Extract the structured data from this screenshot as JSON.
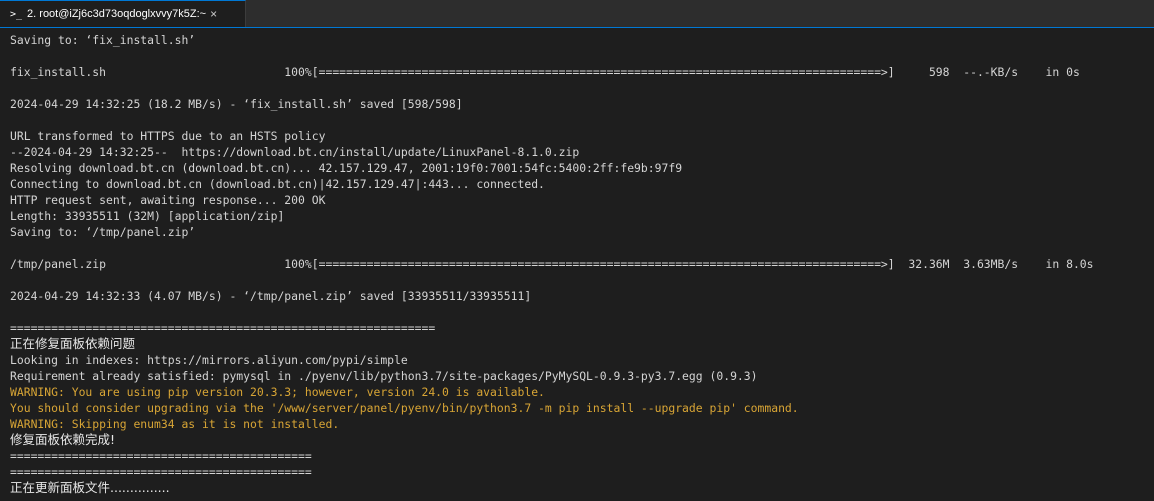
{
  "tab": {
    "prompt_glyph": ">_",
    "title": "2. root@iZj6c3d73oqdoglxvvy7k5Z:~",
    "close_glyph": "×"
  },
  "terminal": {
    "lines": [
      {
        "text": "Saving to: ‘fix_install.sh’",
        "style": "normal"
      },
      {
        "text": "",
        "style": "normal"
      },
      {
        "text": "fix_install.sh                          100%[==================================================================================>]     598  --.-KB/s    in 0s",
        "style": "normal"
      },
      {
        "text": "",
        "style": "normal"
      },
      {
        "text": "2024-04-29 14:32:25 (18.2 MB/s) - ‘fix_install.sh’ saved [598/598]",
        "style": "normal"
      },
      {
        "text": "",
        "style": "normal"
      },
      {
        "text": "URL transformed to HTTPS due to an HSTS policy",
        "style": "normal"
      },
      {
        "text": "--2024-04-29 14:32:25--  https://download.bt.cn/install/update/LinuxPanel-8.1.0.zip",
        "style": "normal"
      },
      {
        "text": "Resolving download.bt.cn (download.bt.cn)... 42.157.129.47, 2001:19f0:7001:54fc:5400:2ff:fe9b:97f9",
        "style": "normal"
      },
      {
        "text": "Connecting to download.bt.cn (download.bt.cn)|42.157.129.47|:443... connected.",
        "style": "normal"
      },
      {
        "text": "HTTP request sent, awaiting response... 200 OK",
        "style": "normal"
      },
      {
        "text": "Length: 33935511 (32M) [application/zip]",
        "style": "normal"
      },
      {
        "text": "Saving to: ‘/tmp/panel.zip’",
        "style": "normal"
      },
      {
        "text": "",
        "style": "normal"
      },
      {
        "text": "/tmp/panel.zip                          100%[==================================================================================>]  32.36M  3.63MB/s    in 8.0s",
        "style": "normal"
      },
      {
        "text": "",
        "style": "normal"
      },
      {
        "text": "2024-04-29 14:32:33 (4.07 MB/s) - ‘/tmp/panel.zip’ saved [33935511/33935511]",
        "style": "normal"
      },
      {
        "text": "",
        "style": "normal"
      },
      {
        "text": "==============================================================",
        "style": "normal"
      },
      {
        "text": "正在修复面板依赖问题",
        "style": "cjk"
      },
      {
        "text": "Looking in indexes: https://mirrors.aliyun.com/pypi/simple",
        "style": "normal"
      },
      {
        "text": "Requirement already satisfied: pymysql in ./pyenv/lib/python3.7/site-packages/PyMySQL-0.9.3-py3.7.egg (0.9.3)",
        "style": "normal"
      },
      {
        "text": "WARNING: You are using pip version 20.3.3; however, version 24.0 is available.",
        "style": "warn"
      },
      {
        "text": "You should consider upgrading via the '/www/server/panel/pyenv/bin/python3.7 -m pip install --upgrade pip' command.",
        "style": "warn"
      },
      {
        "text": "WARNING: Skipping enum34 as it is not installed.",
        "style": "warn"
      },
      {
        "text": "修复面板依赖完成!",
        "style": "cjk"
      },
      {
        "text": "============================================",
        "style": "normal"
      },
      {
        "text": "============================================",
        "style": "normal"
      },
      {
        "text": "正在更新面板文件...............",
        "style": "cjk"
      }
    ]
  }
}
